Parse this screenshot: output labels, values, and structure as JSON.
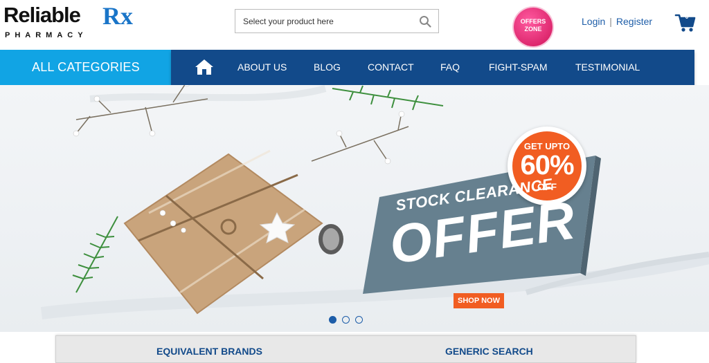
{
  "header": {
    "logo": {
      "word": "Reliable",
      "rx": "Rx",
      "sub": "PHARMACY"
    },
    "search": {
      "placeholder": "Select your product here",
      "icon": "search-icon"
    },
    "offers_zone": {
      "line1": "OFFERS",
      "line2": "ZONE"
    },
    "login_label": "Login",
    "separator": "|",
    "register_label": "Register",
    "cart": {
      "count": "0",
      "icon": "cart-icon"
    }
  },
  "nav": {
    "categories_label": "ALL CATEGORIES",
    "home_icon": "home-icon",
    "items": [
      {
        "label": "ABOUT US"
      },
      {
        "label": "BLOG"
      },
      {
        "label": "CONTACT"
      },
      {
        "label": "FAQ"
      },
      {
        "label": "FIGHT-SPAM"
      },
      {
        "label": "TESTIMONIAL"
      }
    ]
  },
  "hero": {
    "badge_top": "GET UPTO",
    "badge_pct": "60%",
    "badge_off": "OFF",
    "headline": "STOCK CLEARANCE",
    "headline_big": "OFFER",
    "cta_label": "SHOP NOW",
    "slide_count": 3,
    "active_slide": 1
  },
  "search_tabs": {
    "left_label": "EQUIVALENT BRANDS",
    "right_label": "GENERIC SEARCH"
  },
  "colors": {
    "brand_blue": "#124a8a",
    "accent_cyan": "#11a4e4",
    "accent_orange": "#f15d22",
    "offers_pink": "#d0145a",
    "banner_slate": "#66808f"
  }
}
